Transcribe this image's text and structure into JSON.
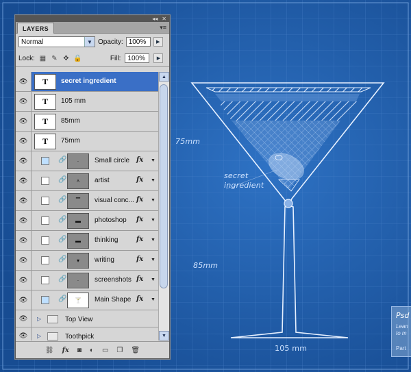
{
  "labels": {
    "dim_75": "75mm",
    "dim_85": "85mm",
    "dim_105": "105 mm",
    "callout_line1": "secret",
    "callout_line2": "ingredient"
  },
  "panel": {
    "tab": "LAYERS",
    "blend_mode": "Normal",
    "opacity_label": "Opacity:",
    "opacity_value": "100%",
    "lock_label": "Lock:",
    "fill_label": "Fill:",
    "fill_value": "100%"
  },
  "text_layers": [
    "secret ingredient",
    "105 mm",
    "85mm",
    "75mm"
  ],
  "shape_layers": [
    "Small circle",
    "artist",
    "visual conc...",
    "photoshop",
    "thinking",
    "writing",
    "screenshots",
    "Main Shape"
  ],
  "groups": [
    "Top View",
    "Toothpick"
  ],
  "fx_label": "fx",
  "infobox": {
    "title": "Psd",
    "line1": "Lean",
    "line2": "to m",
    "footer": "Part"
  },
  "colors": {
    "blueprint_bg": "#1d5aa6",
    "grid_line": "#4f86cc",
    "glass_line": "#e6f0ff",
    "selected": "#3a6fc6"
  }
}
